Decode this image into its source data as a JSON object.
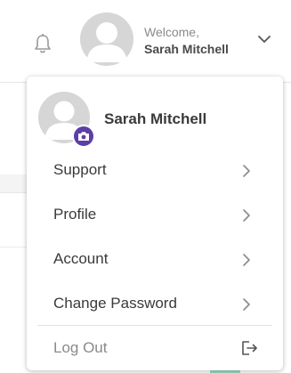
{
  "header": {
    "welcome": "Welcome,",
    "user_name": "Sarah Mitchell",
    "bell_icon": "bell-icon",
    "chevron_icon": "chevron-down-icon"
  },
  "menu": {
    "user_name": "Sarah Mitchell",
    "camera_icon": "camera-icon",
    "accent_color": "#5b3fa6",
    "items": [
      {
        "label": "Support"
      },
      {
        "label": "Profile"
      },
      {
        "label": "Account"
      },
      {
        "label": "Change Password"
      }
    ],
    "logout_label": "Log Out",
    "logout_icon": "logout-icon"
  }
}
